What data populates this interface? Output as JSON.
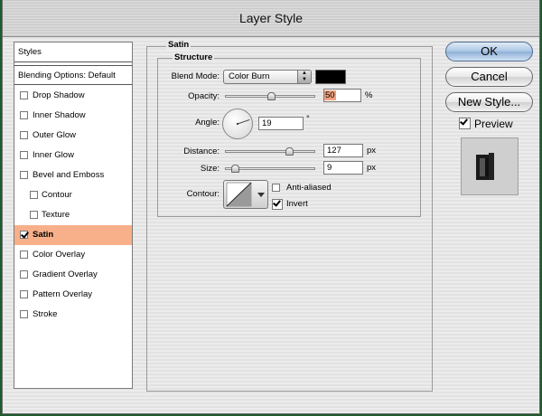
{
  "window": {
    "title": "Layer Style"
  },
  "styles_list": {
    "header": "Styles",
    "blending_options": "Blending Options: Default",
    "items": [
      {
        "label": "Drop Shadow",
        "checked": false,
        "sub": false,
        "selected": false
      },
      {
        "label": "Inner Shadow",
        "checked": false,
        "sub": false,
        "selected": false
      },
      {
        "label": "Outer Glow",
        "checked": false,
        "sub": false,
        "selected": false
      },
      {
        "label": "Inner Glow",
        "checked": false,
        "sub": false,
        "selected": false
      },
      {
        "label": "Bevel and Emboss",
        "checked": false,
        "sub": false,
        "selected": false
      },
      {
        "label": "Contour",
        "checked": false,
        "sub": true,
        "selected": false
      },
      {
        "label": "Texture",
        "checked": false,
        "sub": true,
        "selected": false
      },
      {
        "label": "Satin",
        "checked": true,
        "sub": false,
        "selected": true
      },
      {
        "label": "Color Overlay",
        "checked": false,
        "sub": false,
        "selected": false
      },
      {
        "label": "Gradient Overlay",
        "checked": false,
        "sub": false,
        "selected": false
      },
      {
        "label": "Pattern Overlay",
        "checked": false,
        "sub": false,
        "selected": false
      },
      {
        "label": "Stroke",
        "checked": false,
        "sub": false,
        "selected": false
      }
    ]
  },
  "satin": {
    "section_title": "Satin",
    "structure_title": "Structure",
    "blend_mode_label": "Blend Mode:",
    "blend_mode_value": "Color Burn",
    "blend_color": "#000000",
    "opacity_label": "Opacity:",
    "opacity_value": "50",
    "opacity_unit": "%",
    "angle_label": "Angle:",
    "angle_value": "19",
    "angle_unit": "°",
    "distance_label": "Distance:",
    "distance_value": "127",
    "distance_unit": "px",
    "size_label": "Size:",
    "size_value": "9",
    "size_unit": "px",
    "contour_label": "Contour:",
    "anti_aliased_label": "Anti-aliased",
    "anti_aliased_checked": false,
    "invert_label": "Invert",
    "invert_checked": true
  },
  "buttons": {
    "ok": "OK",
    "cancel": "Cancel",
    "new_style": "New Style...",
    "preview_label": "Preview",
    "preview_checked": true
  },
  "colors": {
    "selected_row": "#f8b08a",
    "opacity_field_highlight": "#f0a080",
    "background": "#1f5a2e"
  }
}
